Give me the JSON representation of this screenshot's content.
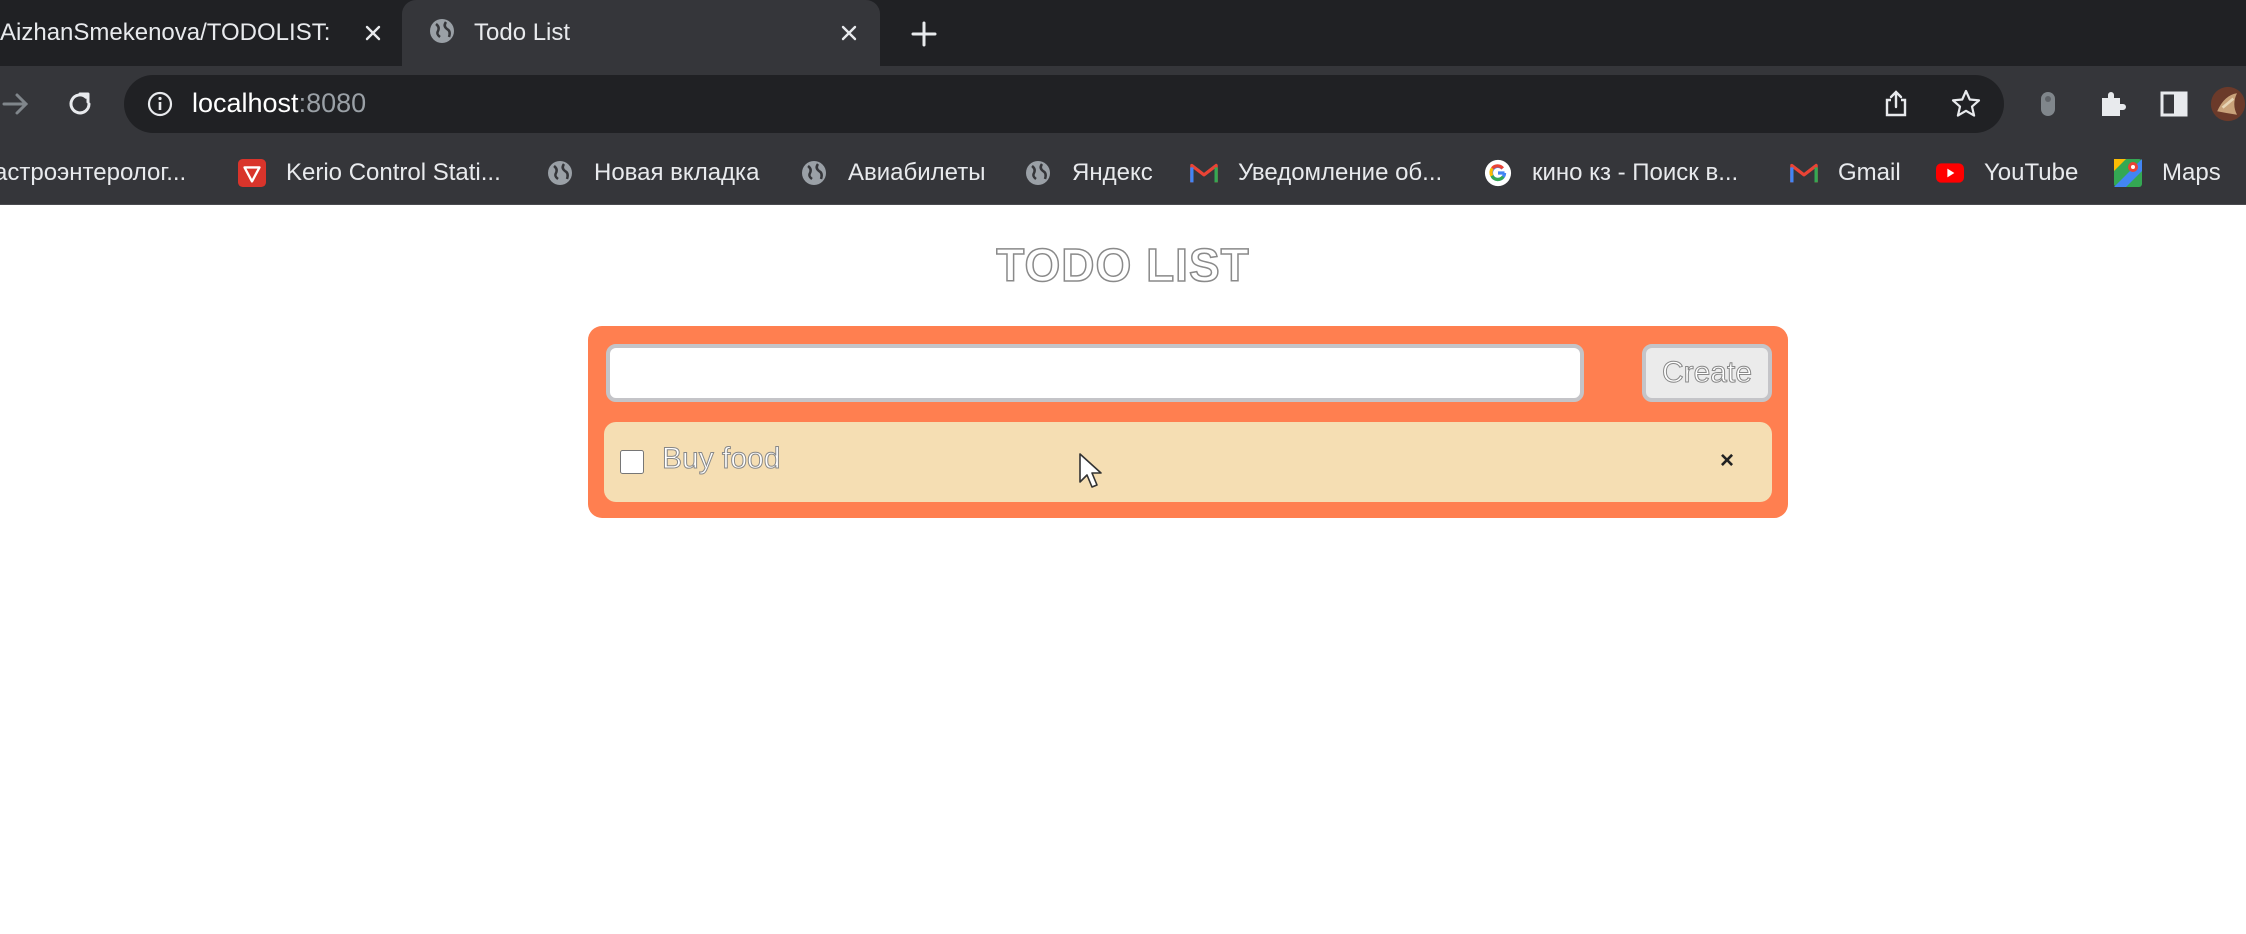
{
  "browser": {
    "tabs": [
      {
        "title": "AizhanSmekenova/TODOLIST:",
        "active": false,
        "close_label": "✕"
      },
      {
        "title": "Todo List",
        "active": true,
        "close_label": "✕"
      }
    ],
    "new_tab_label": "+",
    "address": {
      "host": "localhost",
      "port": ":8080"
    },
    "bookmarks": [
      {
        "label": "астроэнтеролог...",
        "icon": "none"
      },
      {
        "label": "Kerio Control Stati...",
        "icon": "kerio-icon"
      },
      {
        "label": "Новая вкладка",
        "icon": "globe-icon"
      },
      {
        "label": "Авиабилеты",
        "icon": "globe-icon"
      },
      {
        "label": "Яндекс",
        "icon": "globe-icon"
      },
      {
        "label": "Уведомление об...",
        "icon": "gmail-icon"
      },
      {
        "label": "кино кз - Поиск в...",
        "icon": "google-icon"
      },
      {
        "label": "Gmail",
        "icon": "gmail-icon"
      },
      {
        "label": "YouTube",
        "icon": "youtube-icon"
      },
      {
        "label": "Maps",
        "icon": "maps-icon"
      }
    ]
  },
  "app": {
    "title": "TODO LIST",
    "input": {
      "value": "",
      "placeholder": ""
    },
    "create_label": "Create",
    "todos": [
      {
        "text": "Buy food",
        "done": false,
        "delete_label": "×"
      }
    ]
  },
  "colors": {
    "container": "#ff7f50",
    "item": "#f5deb3",
    "chrome_dark": "#202124",
    "chrome_toolbar": "#35363a"
  }
}
